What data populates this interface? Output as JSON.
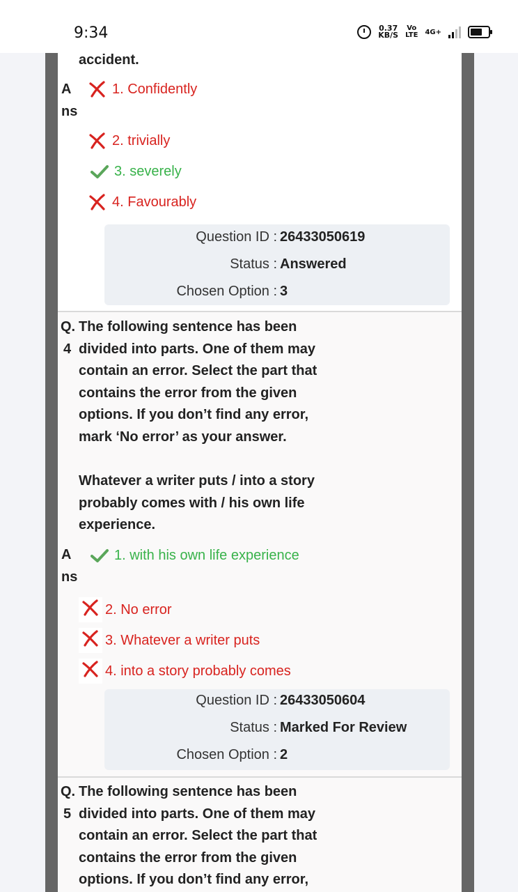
{
  "status_bar": {
    "time": "9:34",
    "speed_value": "0.37",
    "speed_unit": "KB/S",
    "volte_top": "Vo",
    "volte_bottom": "LTE",
    "network": "4G+"
  },
  "prev_question": {
    "text_tail": "accident.",
    "ans_label_top": "A",
    "ans_label_bottom": "ns",
    "options": [
      {
        "label": "1. Confidently",
        "status": "wrong"
      },
      {
        "label": "2. trivially",
        "status": "wrong"
      },
      {
        "label": "3. severely",
        "status": "correct"
      },
      {
        "label": "4. Favourably",
        "status": "wrong"
      }
    ],
    "info": {
      "question_id_label": "Question ID :",
      "question_id": "26433050619",
      "status_label": "Status :",
      "status": "Answered",
      "chosen_label": "Chosen Option :",
      "chosen": "3"
    }
  },
  "question4": {
    "q_label": "Q.",
    "q_number": "4",
    "lines": [
      "The following sentence has been",
      "divided into parts. One of them may",
      "contain an error. Select the part that",
      "contains the error from the given",
      "options. If you don’t find any error,",
      "mark ‘No error’ as your answer.",
      "",
      "Whatever a writer puts / into a story",
      "probably comes with / his own life",
      "experience."
    ],
    "ans_label_top": "A",
    "ans_label_bottom": "ns",
    "options": [
      {
        "label": "1. with his own life experience",
        "status": "correct"
      },
      {
        "label": "2. No error",
        "status": "wrong"
      },
      {
        "label": "3. Whatever a writer puts",
        "status": "wrong"
      },
      {
        "label": "4. into a story probably comes",
        "status": "wrong"
      }
    ],
    "info": {
      "question_id_label": "Question ID :",
      "question_id": "26433050604",
      "status_label": "Status :",
      "status": "Marked For Review",
      "chosen_label": "Chosen Option :",
      "chosen": "2"
    }
  },
  "question5": {
    "q_label": "Q.",
    "q_number": "5",
    "lines": [
      "The following sentence has been",
      "divided into parts. One of them may",
      "contain an error. Select the part that",
      "contains the error from the given",
      "options. If you don’t find any error,"
    ]
  },
  "colors": {
    "wrong": "#d8231f",
    "correct": "#38b24a",
    "info_bg": "#edf0f4",
    "frame": "#666666"
  },
  "icons": {
    "wrong": "cross-icon",
    "correct": "check-icon"
  }
}
